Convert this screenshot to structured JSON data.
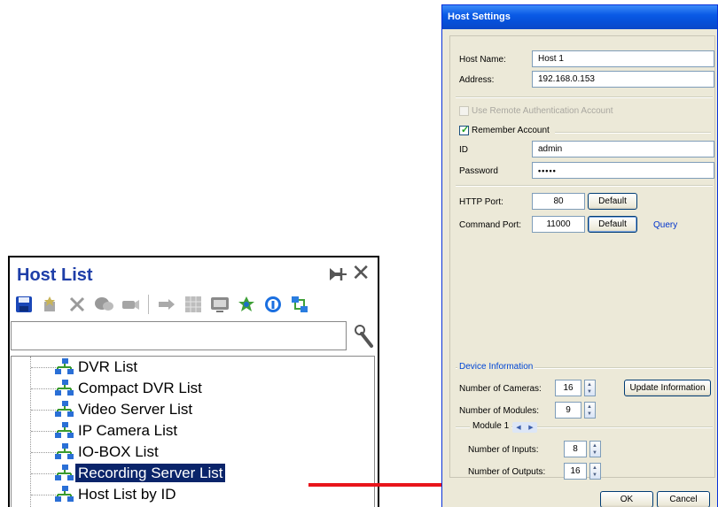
{
  "host_list": {
    "title": "Host List",
    "search_value": "",
    "toolbar_icons": [
      "save-icon",
      "add-host-icon",
      "delete-icon",
      "chat-icon",
      "camera-icon",
      "play-icon",
      "grid-icon",
      "monitor-icon",
      "add-green-icon",
      "info-icon",
      "network-icon"
    ],
    "tree_items": [
      {
        "label": "DVR List",
        "selected": false
      },
      {
        "label": "Compact DVR List",
        "selected": false
      },
      {
        "label": "Video Server List",
        "selected": false
      },
      {
        "label": "IP Camera List",
        "selected": false
      },
      {
        "label": "IO-BOX List",
        "selected": false
      },
      {
        "label": "Recording Server List",
        "selected": true
      },
      {
        "label": "Host List by ID",
        "selected": false
      }
    ]
  },
  "dialog": {
    "title": "Host Settings",
    "host_name_label": "Host Name:",
    "host_name_value": "Host 1",
    "address_label": "Address:",
    "address_value": "192.168.0.153",
    "use_remote_auth_label": "Use Remote Authentication Account",
    "remember_account_label": "Remember Account",
    "id_label": "ID",
    "id_value": "admin",
    "password_label": "Password",
    "password_value": "•••••",
    "http_port_label": "HTTP Port:",
    "http_port_value": "80",
    "command_port_label": "Command Port:",
    "command_port_value": "11000",
    "default_label": "Default",
    "query_label": "Query",
    "device_info_label": "Device Information",
    "num_cameras_label": "Number of Cameras:",
    "num_cameras_value": "16",
    "update_info_label": "Update Information",
    "num_modules_label": "Number of Modules:",
    "num_modules_value": "9",
    "module_label": "Module 1",
    "num_inputs_label": "Number of Inputs:",
    "num_inputs_value": "8",
    "num_outputs_label": "Number of Outputs:",
    "num_outputs_value": "16",
    "ok_label": "OK",
    "cancel_label": "Cancel"
  },
  "colors": {
    "host_list_title": "#1e3ea8",
    "selection": "#0a246a",
    "arrow": "#e8141b",
    "titlebar": "#0a5ae6",
    "dialog_bg": "#ece9d8"
  }
}
